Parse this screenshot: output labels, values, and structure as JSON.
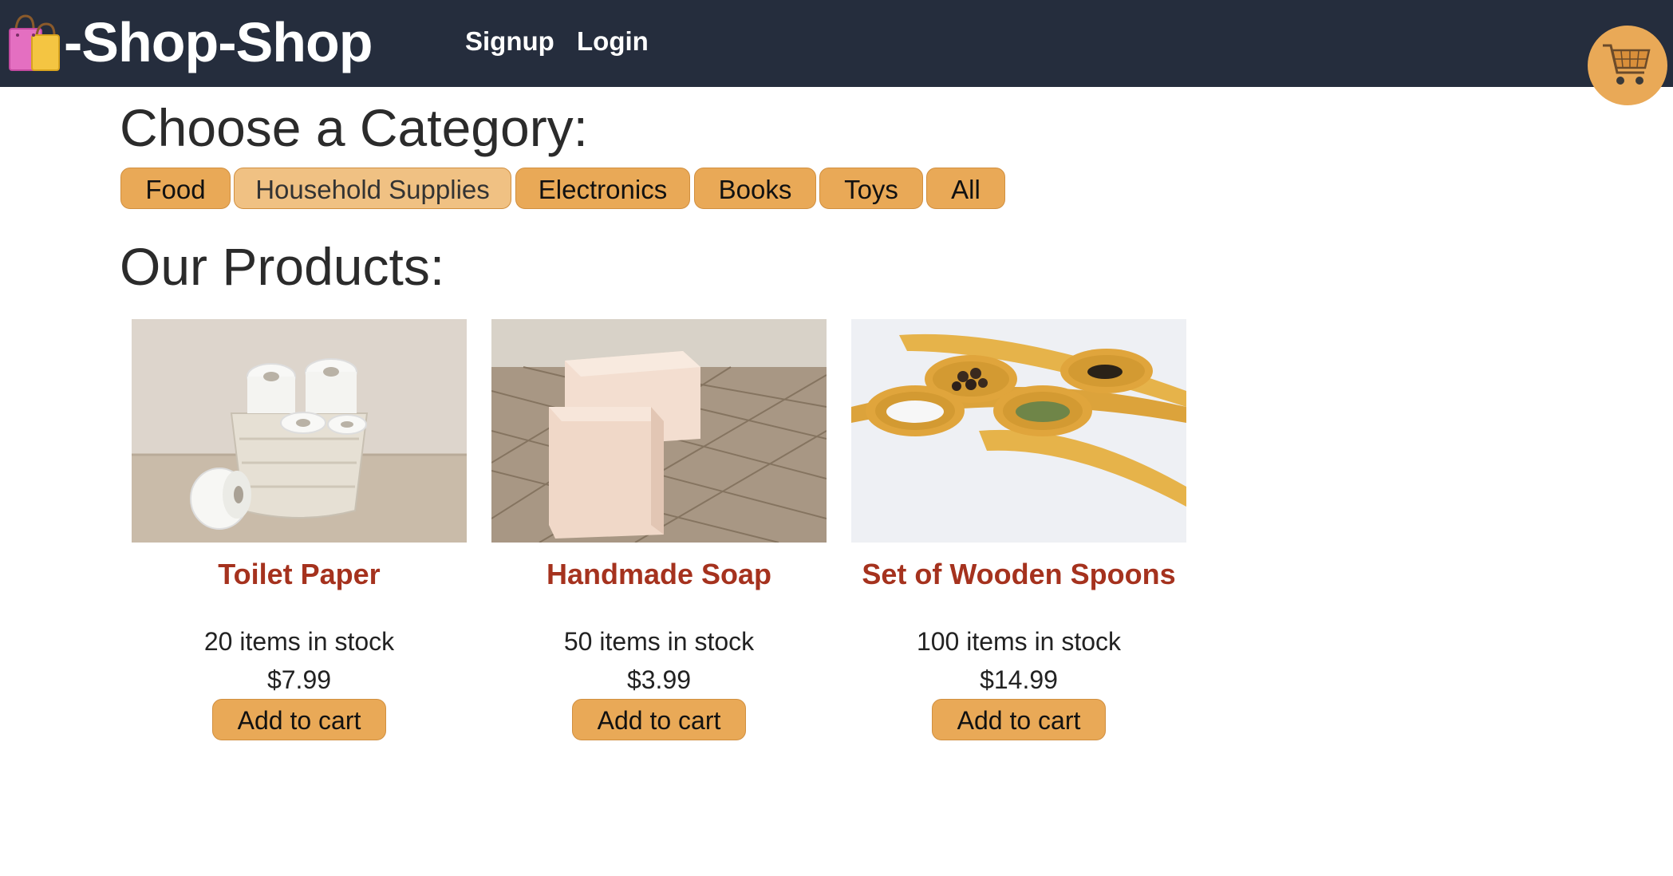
{
  "header": {
    "brand": "-Shop-Shop",
    "brand_icon": "shopping-bags-icon",
    "nav": {
      "signup": "Signup",
      "login": "Login"
    },
    "cart_icon": "shopping-cart-icon",
    "bg_color": "#252d3d",
    "accent_color": "#e9a957"
  },
  "categories": {
    "heading": "Choose a Category:",
    "items": [
      {
        "label": "Food"
      },
      {
        "label": "Household Supplies",
        "selected": true
      },
      {
        "label": "Electronics"
      },
      {
        "label": "Books"
      },
      {
        "label": "Toys"
      },
      {
        "label": "All"
      }
    ]
  },
  "products": {
    "heading": "Our Products:",
    "items": [
      {
        "name": "Toilet Paper",
        "stock": "20 items in stock",
        "price": "$7.99",
        "button": "Add to cart",
        "image": "toilet-paper-photo"
      },
      {
        "name": "Handmade Soap",
        "stock": "50 items in stock",
        "price": "$3.99",
        "button": "Add to cart",
        "image": "soap-photo"
      },
      {
        "name": "Set of Wooden Spoons",
        "stock": "100 items in stock",
        "price": "$14.99",
        "button": "Add to cart",
        "image": "wooden-spoons-photo"
      }
    ]
  }
}
